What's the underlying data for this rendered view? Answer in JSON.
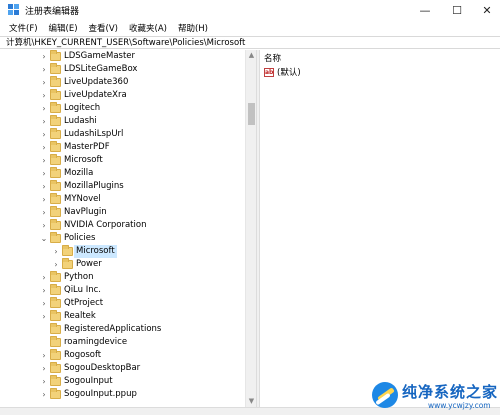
{
  "window": {
    "title": "注册表编辑器",
    "minimize_glyph": "—",
    "maximize_glyph": "☐",
    "close_glyph": "✕"
  },
  "menu": [
    {
      "label": "文件(F)"
    },
    {
      "label": "编辑(E)"
    },
    {
      "label": "查看(V)"
    },
    {
      "label": "收藏夹(A)"
    },
    {
      "label": "帮助(H)"
    }
  ],
  "address": {
    "path": "计算机\\HKEY_CURRENT_USER\\Software\\Policies\\Microsoft"
  },
  "tree": {
    "items": [
      {
        "label": "LDSGameMaster",
        "level": 1,
        "expander": "collapsed",
        "selected": false
      },
      {
        "label": "LDSLiteGameBox",
        "level": 1,
        "expander": "collapsed",
        "selected": false
      },
      {
        "label": "LiveUpdate360",
        "level": 1,
        "expander": "collapsed",
        "selected": false
      },
      {
        "label": "LiveUpdateXra",
        "level": 1,
        "expander": "collapsed",
        "selected": false
      },
      {
        "label": "Logitech",
        "level": 1,
        "expander": "collapsed",
        "selected": false
      },
      {
        "label": "Ludashi",
        "level": 1,
        "expander": "collapsed",
        "selected": false
      },
      {
        "label": "LudashiLspUrl",
        "level": 1,
        "expander": "collapsed",
        "selected": false
      },
      {
        "label": "MasterPDF",
        "level": 1,
        "expander": "collapsed",
        "selected": false
      },
      {
        "label": "Microsoft",
        "level": 1,
        "expander": "collapsed",
        "selected": false
      },
      {
        "label": "Mozilla",
        "level": 1,
        "expander": "collapsed",
        "selected": false
      },
      {
        "label": "MozillaPlugins",
        "level": 1,
        "expander": "collapsed",
        "selected": false
      },
      {
        "label": "MYNovel",
        "level": 1,
        "expander": "collapsed",
        "selected": false
      },
      {
        "label": "NavPlugin",
        "level": 1,
        "expander": "collapsed",
        "selected": false
      },
      {
        "label": "NVIDIA Corporation",
        "level": 1,
        "expander": "collapsed",
        "selected": false
      },
      {
        "label": "Policies",
        "level": 1,
        "expander": "expanded",
        "selected": false
      },
      {
        "label": "Microsoft",
        "level": 2,
        "expander": "collapsed",
        "selected": true
      },
      {
        "label": "Power",
        "level": 2,
        "expander": "collapsed",
        "selected": false
      },
      {
        "label": "Python",
        "level": 1,
        "expander": "collapsed",
        "selected": false
      },
      {
        "label": "QiLu Inc.",
        "level": 1,
        "expander": "collapsed",
        "selected": false
      },
      {
        "label": "QtProject",
        "level": 1,
        "expander": "collapsed",
        "selected": false
      },
      {
        "label": "Realtek",
        "level": 1,
        "expander": "collapsed",
        "selected": false
      },
      {
        "label": "RegisteredApplications",
        "level": 1,
        "expander": "none",
        "selected": false
      },
      {
        "label": "roamingdevice",
        "level": 1,
        "expander": "none",
        "selected": false
      },
      {
        "label": "Rogosoft",
        "level": 1,
        "expander": "collapsed",
        "selected": false
      },
      {
        "label": "SogouDesktopBar",
        "level": 1,
        "expander": "collapsed",
        "selected": false
      },
      {
        "label": "SogouInput",
        "level": 1,
        "expander": "collapsed",
        "selected": false
      },
      {
        "label": "SogouInput.ppup",
        "level": 1,
        "expander": "collapsed",
        "selected": false
      }
    ]
  },
  "values_pane": {
    "column_name": "名称",
    "rows": [
      {
        "icon": "string-value-icon",
        "icon_text": "ab",
        "name": "(默认)"
      }
    ]
  },
  "watermark": {
    "text": "纯净系统之家",
    "url": "www.ycwjzy.com"
  },
  "colors": {
    "folder": "#f2d27a",
    "selection": "#cce8ff",
    "watermark_blue": "#1565c0"
  }
}
